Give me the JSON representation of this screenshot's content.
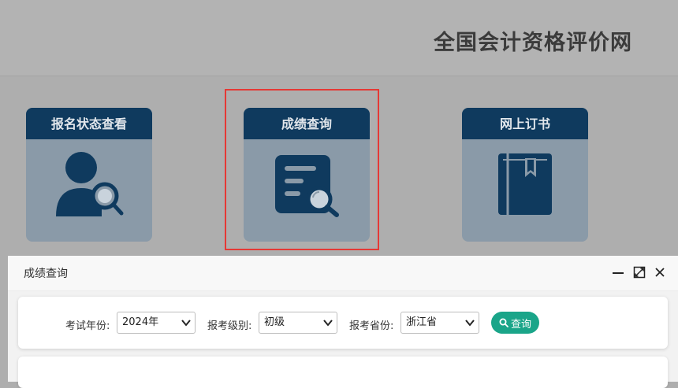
{
  "header": {
    "site_title": "全国会计资格评价网"
  },
  "cards": [
    {
      "label": "报名状态查看",
      "icon": "user-search-icon"
    },
    {
      "label": "成绩查询",
      "icon": "document-search-icon"
    },
    {
      "label": "网上订书",
      "icon": "book-icon"
    }
  ],
  "dialog": {
    "title": "成绩查询",
    "controls": [
      "minimize-icon",
      "maximize-icon",
      "close-icon"
    ],
    "filters": {
      "year": {
        "label": "考试年份:",
        "value": "2024年"
      },
      "level": {
        "label": "报考级别:",
        "value": "初级"
      },
      "province": {
        "label": "报考省份:",
        "value": "浙江省"
      }
    },
    "query_button": "查询"
  },
  "colors": {
    "card_header": "#0f3a5e",
    "card_body": "#8a9aa8",
    "highlight": "#e53935",
    "query_button": "#1aa589"
  }
}
